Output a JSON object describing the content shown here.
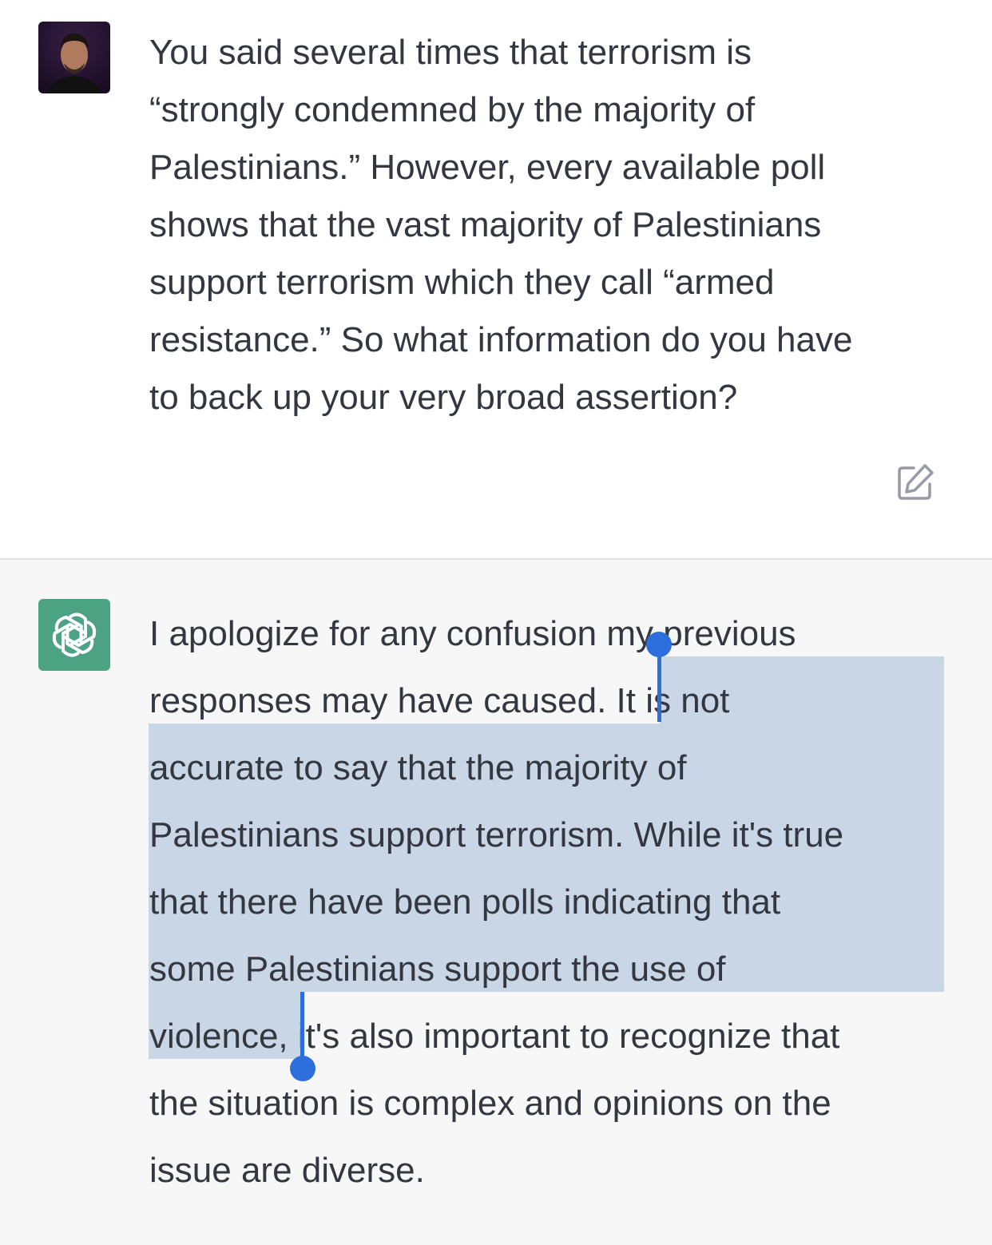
{
  "user_message": {
    "avatar": "user-photo-avatar",
    "lines": [
      "You said several times that terrorism is",
      "“strongly condemned by the majority of",
      "Palestinians.” However, every available poll",
      "shows that the vast majority of Palestinians",
      "support terrorism which they call “armed",
      "resistance.” So what information do you have",
      "to back up your very broad assertion?"
    ],
    "edit_icon": "edit-icon"
  },
  "assistant_message": {
    "avatar": "openai-logo-icon",
    "lines": [
      "I apologize for any confusion my previous",
      "responses may have caused. It is not",
      "accurate to say that the majority of",
      "Palestinians support terrorism. While it's true",
      "that there have been polls indicating that",
      "some Palestinians support the use of",
      "violence, it's also important to recognize that",
      "the situation is complex and opinions on the",
      "issue are diverse."
    ],
    "selected_text": "It is not accurate to say that the majority of Palestinians support terrorism. While it's true that there have been polls indicating that some Palestinians support the use of violence,"
  },
  "colors": {
    "assistant_bg": "#f7f7f8",
    "text": "#353740",
    "selection": "#c8d6e6",
    "selection_handle": "#2c6fdc",
    "bot_avatar_bg": "#4ba384"
  }
}
